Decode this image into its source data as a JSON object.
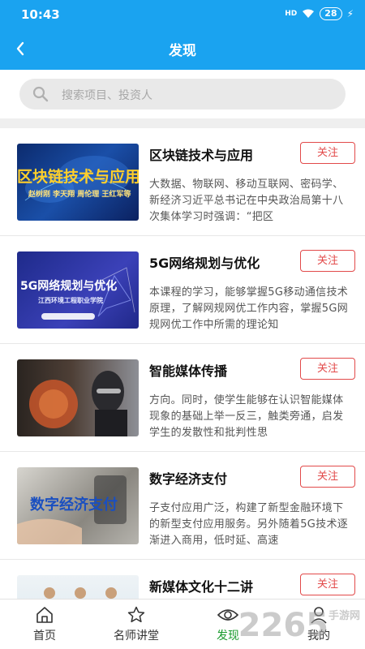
{
  "status": {
    "time": "10:43",
    "signal": "HD",
    "battery": "28",
    "bolt": "⚡"
  },
  "header": {
    "title": "发现"
  },
  "search": {
    "placeholder": "搜索项目、投资人"
  },
  "follow_label": "关注",
  "items": [
    {
      "title": "区块链技术与应用",
      "desc": "大数据、物联网、移动互联网、密码学、新经济习近平总书记在中央政治局第十八次集体学习时强调：“把区",
      "thumb_caption": "区块链技术与应用",
      "thumb_sub": "赵树刚 李天翔 周伦理 王红军等"
    },
    {
      "title": "5G网络规划与优化",
      "desc": "本课程的学习，能够掌握5G移动通信技术原理，了解网规网优工作内容，掌握5G网规网优工作中所需的理论知",
      "thumb_caption": "5G网络规划与优化",
      "thumb_sub": "江西环境工程职业学院"
    },
    {
      "title": "智能媒体传播",
      "desc": "方向。同时，使学生能够在认识智能媒体现象的基础上举一反三，触类旁通，启发学生的发散性和批判性思",
      "thumb_caption": "",
      "thumb_sub": ""
    },
    {
      "title": "数字经济支付",
      "desc": "子支付应用广泛，构建了新型金融环境下的新型支付应用服务。另外随着5G技术逐渐进入商用，低时延、高速",
      "thumb_caption": "数字经济支付",
      "thumb_sub": ""
    },
    {
      "title": "新媒体文化十二讲",
      "desc": "",
      "thumb_caption": "",
      "thumb_sub": ""
    }
  ],
  "tabs": [
    {
      "label": "首页",
      "icon": "home-icon"
    },
    {
      "label": "名师讲堂",
      "icon": "star-icon"
    },
    {
      "label": "发现",
      "icon": "eye-icon"
    },
    {
      "label": "我的",
      "icon": "user-icon"
    }
  ],
  "watermark": {
    "main": "2265",
    "sub": "手游网"
  },
  "colors": {
    "primary": "#1aa3f0",
    "follow": "#e24a4a",
    "active_tab": "#1a9b2e"
  }
}
